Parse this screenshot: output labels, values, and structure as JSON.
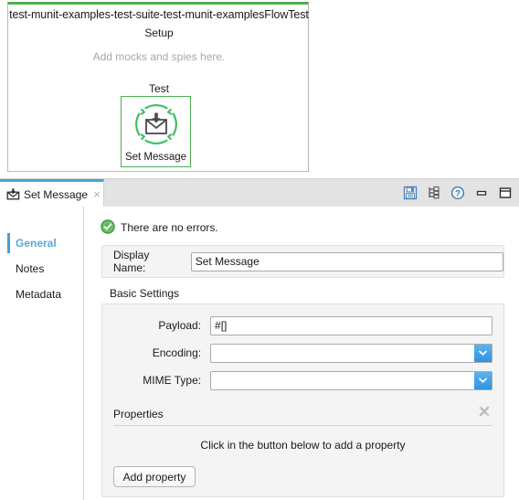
{
  "canvas": {
    "flow_title": "test-munit-examples-test-suite-test-munit-examplesFlowTest",
    "setup_label": "Setup",
    "setup_hint": "Add mocks and spies here.",
    "test_label": "Test",
    "node_label": "Set Message",
    "node_icon": "set-message-envelope-icon",
    "accent_color": "#4caf50"
  },
  "panel": {
    "tab": {
      "label": "Set Message",
      "icon": "envelope-icon",
      "close_label": "×",
      "active_color": "#4aa3df"
    },
    "toolbar": [
      {
        "name": "save-icon",
        "title": "Save"
      },
      {
        "name": "tree-view-icon",
        "title": "Tree view"
      },
      {
        "name": "help-icon",
        "title": "Help"
      },
      {
        "name": "minimize-icon",
        "title": "Minimize"
      },
      {
        "name": "maximize-icon",
        "title": "Maximize"
      }
    ],
    "nav": [
      {
        "label": "General",
        "selected": true
      },
      {
        "label": "Notes",
        "selected": false
      },
      {
        "label": "Metadata",
        "selected": false
      }
    ],
    "status": {
      "icon": "success-check-icon",
      "text": "There are no errors."
    },
    "display_name": {
      "label": "Display Name:",
      "value": "Set Message",
      "placeholder": ""
    },
    "basic_settings": {
      "title": "Basic Settings",
      "payload": {
        "label": "Payload:",
        "value": "#[]",
        "placeholder": ""
      },
      "encoding": {
        "label": "Encoding:",
        "value": "",
        "placeholder": ""
      },
      "mime_type": {
        "label": "MIME Type:",
        "value": "",
        "placeholder": ""
      }
    },
    "properties": {
      "title": "Properties",
      "clear_icon": "clear-properties-icon",
      "hint": "Click in the button below to add a property",
      "add_button_label": "Add property"
    }
  }
}
